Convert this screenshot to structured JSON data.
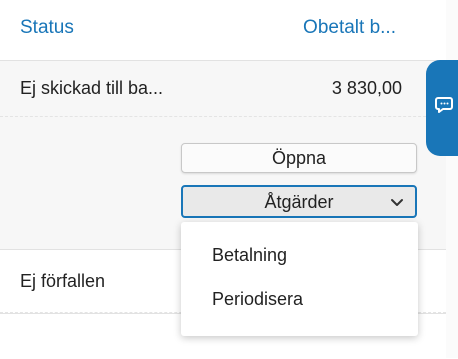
{
  "table": {
    "columns": {
      "status": "Status",
      "unpaid": "Obetalt b..."
    },
    "rows": [
      {
        "status": "Ej skickad till ba...",
        "amount": "3 830,00"
      },
      {
        "status": "Ej förfallen",
        "amount": ""
      }
    ]
  },
  "actions": {
    "open_label": "Öppna",
    "actions_label": "Åtgärder",
    "menu": [
      {
        "label": "Betalning"
      },
      {
        "label": "Periodisera"
      }
    ]
  },
  "colors": {
    "accent": "#1976b8"
  },
  "icons": {
    "chat": "chat-bubbles-icon",
    "chevron": "chevron-down-icon"
  }
}
